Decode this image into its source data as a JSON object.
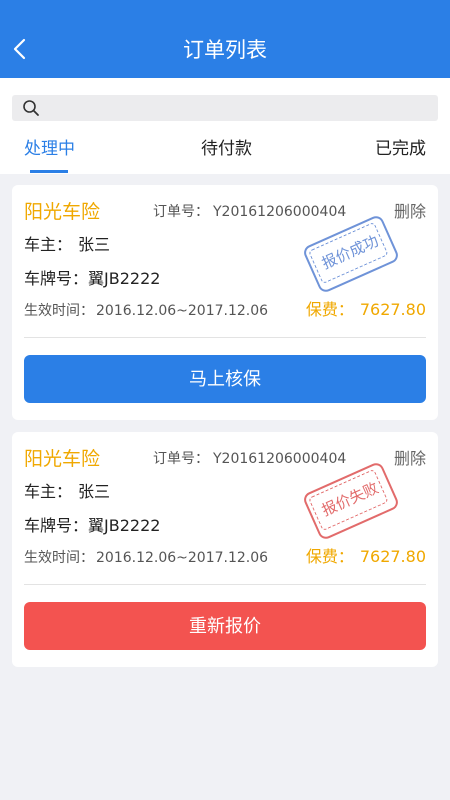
{
  "header": {
    "title": "订单列表",
    "back_icon": "chevron-left-icon"
  },
  "search": {
    "icon": "search-icon",
    "placeholder": ""
  },
  "tabs": [
    {
      "label": "处理中",
      "active": true
    },
    {
      "label": "待付款",
      "active": false
    },
    {
      "label": "已完成",
      "active": false
    }
  ],
  "orders": [
    {
      "company": "阳光车险",
      "order_no_label": "订单号：",
      "order_no": "Y20161206000404",
      "delete_label": "删除",
      "owner_label": "车主：",
      "owner": "张三",
      "plate_label": "车牌号：",
      "plate": "翼JB2222",
      "effective_label": "生效时间：",
      "effective": "2016.12.06~2017.12.06",
      "premium_label": "保费：",
      "premium": "7627.80",
      "stamp": "报价成功",
      "action": "马上核保"
    },
    {
      "company": "阳光车险",
      "order_no_label": "订单号：",
      "order_no": "Y20161206000404",
      "delete_label": "删除",
      "owner_label": "车主：",
      "owner": "张三",
      "plate_label": "车牌号：",
      "plate": "翼JB2222",
      "effective_label": "生效时间：",
      "effective": "2016.12.06~2017.12.06",
      "premium_label": "保费：",
      "premium": "7627.80",
      "stamp": "报价失败",
      "action": "重新报价"
    }
  ],
  "colors": {
    "primary": "#2b7fe6",
    "accent": "#f0a800",
    "danger": "#f35350",
    "stamp_success": "#6f93d8",
    "stamp_fail": "#e26b6b"
  }
}
